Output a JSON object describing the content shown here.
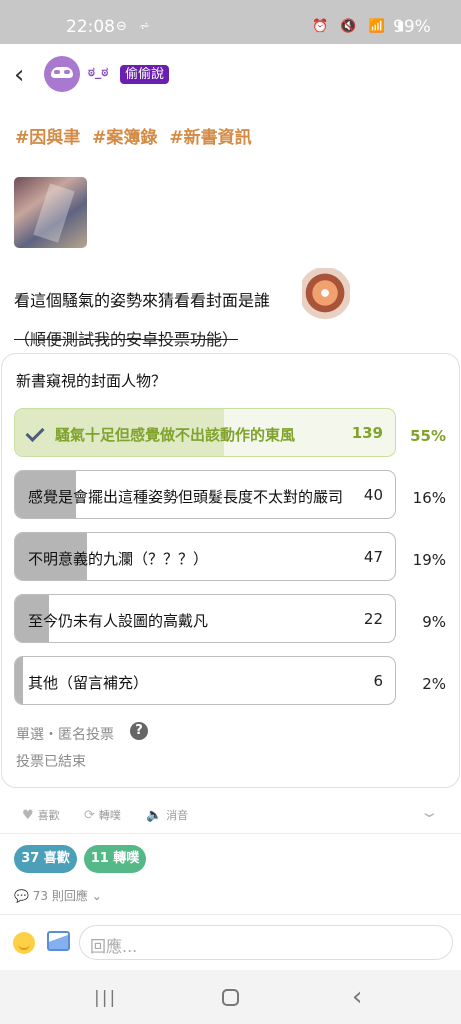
{
  "status_bar": {
    "time": "22:08",
    "left_icons": "⊖ ⩫",
    "right_icons": "⏰ 🔇 📶 ▮",
    "battery": "99%"
  },
  "header": {
    "back_icon": "‹",
    "avatar": "mask-icon",
    "username": "ಠ_ಠ",
    "badge": "偷偷說"
  },
  "post": {
    "tags": [
      "#因與聿",
      "#案簿錄",
      "#新書資訊"
    ],
    "line1": "看這個騷氣的姿勢來猜看看封面是誰",
    "line2": "（順便測試我的安卓投票功能）"
  },
  "poll": {
    "title": "新書窺視的封面人物？",
    "options": [
      {
        "label": "騷氣十足但感覺做不出該動作的東風",
        "count": "139",
        "pct": "55%",
        "value": 55,
        "selected": true
      },
      {
        "label": "感覺是會擺出這種姿勢但頭髮長度不太對的嚴司",
        "count": "40",
        "pct": "16%",
        "value": 16,
        "selected": false
      },
      {
        "label": "不明意義的九瀾（？？？）",
        "count": "47",
        "pct": "19%",
        "value": 19,
        "selected": false
      },
      {
        "label": "至今仍未有人設圖的高戴凡",
        "count": "22",
        "pct": "9%",
        "value": 9,
        "selected": false
      },
      {
        "label": "其他（留言補充）",
        "count": "6",
        "pct": "2%",
        "value": 2,
        "selected": false
      }
    ],
    "meta": "單選・匿名投票",
    "help": "?",
    "status": "投票已結束"
  },
  "actions": {
    "like": {
      "icon": "♥",
      "label": "喜歡"
    },
    "repost": {
      "icon": "⟳",
      "label": "轉噗"
    },
    "mute": {
      "icon": "🔈",
      "label": "消音"
    },
    "more": "⌄"
  },
  "stats": {
    "likes": "37 喜歡",
    "reposts": "11 轉噗"
  },
  "comments": {
    "icon": "💬",
    "text": "73 則回應",
    "chevron": "⌄"
  },
  "reply": {
    "placeholder": "回應..."
  },
  "navbar": {
    "recent": "|||",
    "back": "‹"
  },
  "colors": {
    "accent": "#d48b45",
    "selected": "#7fa32d",
    "likes": "#4b9fb8",
    "reposts": "#55b887"
  }
}
